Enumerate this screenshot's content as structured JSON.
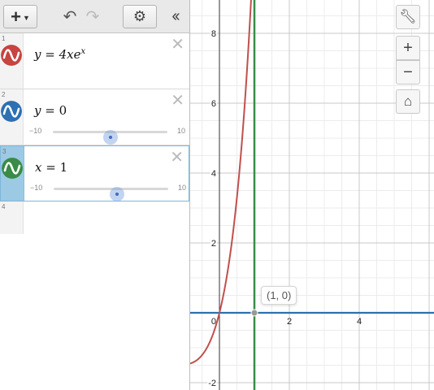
{
  "toolbar": {
    "add_icon": "plus-icon",
    "undo_icon": "undo-icon",
    "redo_icon": "redo-icon",
    "settings_icon": "gear-icon",
    "collapse_icon": "double-chevron-left-icon"
  },
  "expressions": [
    {
      "index": "1",
      "color": "#c74440",
      "latex": "y = 4xe^x",
      "lhs": "y",
      "eq": " = ",
      "rhs": "4xe",
      "sup": "x"
    },
    {
      "index": "2",
      "color": "#2d70b3",
      "lhs": "y",
      "eq": " = ",
      "rhs": "0",
      "slider": {
        "min": "−10",
        "max": "10",
        "value": 0
      }
    },
    {
      "index": "3",
      "color": "#388c46",
      "lhs": "x",
      "eq": " = ",
      "rhs": "1",
      "slider": {
        "min": "−10",
        "max": "10",
        "value": 1
      }
    },
    {
      "index": "4"
    }
  ],
  "graph_controls": {
    "wrench_icon": "wrench-icon",
    "zoom_in_icon": "plus-icon",
    "zoom_out_icon": "minus-icon",
    "home_icon": "home-icon"
  },
  "point_label": "(1, 0)",
  "chart_data": {
    "type": "line",
    "xlim": [
      -0.85,
      6.1
    ],
    "ylim": [
      -2.2,
      8.9
    ],
    "x_ticks": [
      "2",
      "4"
    ],
    "y_ticks": [
      "-2",
      "2",
      "4",
      "6",
      "8"
    ],
    "origin_label": "0",
    "grid": true,
    "series": [
      {
        "expression": "y = 4xe^x",
        "color": "#c0504d"
      },
      {
        "expression": "y = 0",
        "color": "#2d70b3"
      },
      {
        "expression": "x = 1",
        "color": "#388c46"
      }
    ],
    "points": [
      {
        "x": 1,
        "y": 0
      }
    ]
  }
}
